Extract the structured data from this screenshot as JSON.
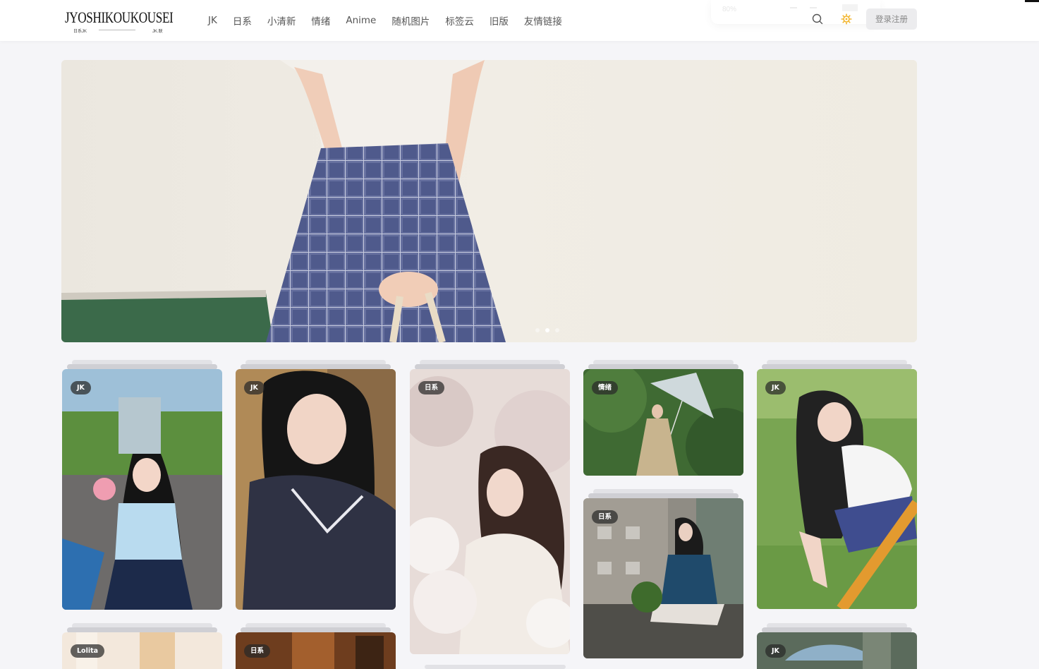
{
  "header": {
    "logo_text": "JYOSHIKOUKOUSEI",
    "logo_sub_left": "日系JK",
    "logo_sub_right": "JK.联",
    "nav": [
      "JK",
      "日系",
      "小清新",
      "情绪",
      "Anime",
      "随机图片",
      "标签云",
      "旧版",
      "友情链接"
    ],
    "ghost_zoom": "80%",
    "login_label": "登录注册"
  },
  "icons": {
    "search": "search-icon",
    "theme": "sun-gear-icon",
    "theme_color": "#f2b42a"
  },
  "banner": {
    "slides": 3,
    "active_slide": 1
  },
  "cards": [
    {
      "tag": "JK"
    },
    {
      "tag": "JK"
    },
    {
      "tag": "日系"
    },
    {
      "tag": "情绪"
    },
    {
      "tag": "JK"
    },
    {
      "tag": "日系"
    },
    {
      "tag": "Lolita"
    },
    {
      "tag": "日系"
    },
    {
      "tag": "JK"
    }
  ],
  "colors": {
    "page_bg": "#f5f5f8",
    "tag_bg": "rgba(40,40,40,0.72)",
    "login_bg": "#ececee"
  }
}
